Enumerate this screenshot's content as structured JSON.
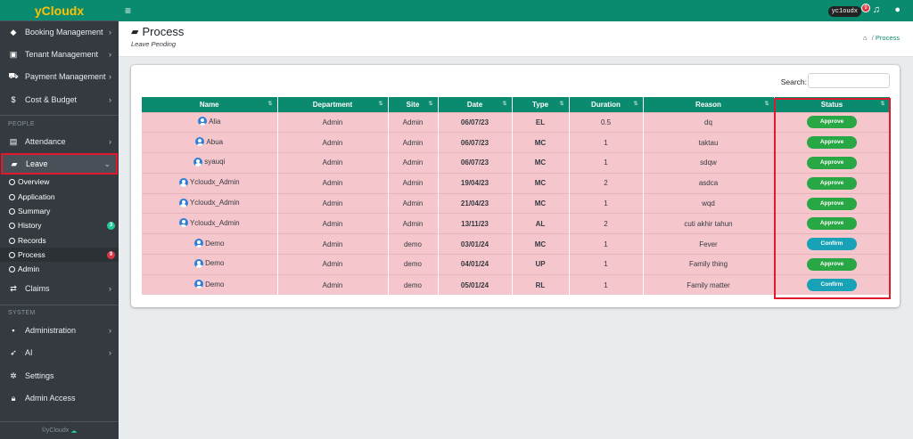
{
  "app": {
    "brand": "yCloudx",
    "footer": "©yCloudx"
  },
  "topbar": {
    "username": "yc1oudx",
    "notifications": "9"
  },
  "sidebar": {
    "main_items": [
      {
        "label": "Booking Management",
        "icon": "key-icon"
      },
      {
        "label": "Tenant Management",
        "icon": "building-icon"
      },
      {
        "label": "Payment Management",
        "icon": "cart-icon"
      },
      {
        "label": "Cost & Budget",
        "icon": "dollar-icon"
      }
    ],
    "section_people": "PEOPLE",
    "attendance": "Attendance",
    "leave": "Leave",
    "leave_sub": [
      {
        "label": "Overview",
        "badge": ""
      },
      {
        "label": "Application",
        "badge": ""
      },
      {
        "label": "Summary",
        "badge": ""
      },
      {
        "label": "History",
        "badge": "3"
      },
      {
        "label": "Records",
        "badge": ""
      },
      {
        "label": "Process",
        "badge": "9"
      },
      {
        "label": "Admin",
        "badge": ""
      }
    ],
    "claims": "Claims",
    "section_system": "SYSTEM",
    "administration": "Administration",
    "ai": "AI",
    "settings": "Settings",
    "admin_access": "Admin Access"
  },
  "header": {
    "title": "Process",
    "subtitle": "Leave Pending",
    "breadcrumb_sep": "/",
    "breadcrumb_current": "Process"
  },
  "search": {
    "label": "Search:"
  },
  "table": {
    "headers": [
      "Name",
      "Department",
      "Site",
      "Date",
      "Type",
      "Duration",
      "Reason",
      "Status"
    ],
    "rows": [
      {
        "name": "Alia",
        "department": "Admin",
        "site": "Admin",
        "date": "06/07/23",
        "type": "EL",
        "duration": "0.5",
        "reason": "dq",
        "status": "Approve"
      },
      {
        "name": "Abua",
        "department": "Admin",
        "site": "Admin",
        "date": "06/07/23",
        "type": "MC",
        "duration": "1",
        "reason": "taktau",
        "status": "Approve"
      },
      {
        "name": "syauqi",
        "department": "Admin",
        "site": "Admin",
        "date": "06/07/23",
        "type": "MC",
        "duration": "1",
        "reason": "sdqw",
        "status": "Approve"
      },
      {
        "name": "Ycloudx_Admin",
        "department": "Admin",
        "site": "Admin",
        "date": "19/04/23",
        "type": "MC",
        "duration": "2",
        "reason": "asdca",
        "status": "Approve"
      },
      {
        "name": "Ycloudx_Admin",
        "department": "Admin",
        "site": "Admin",
        "date": "21/04/23",
        "type": "MC",
        "duration": "1",
        "reason": "wqd",
        "status": "Approve"
      },
      {
        "name": "Ycloudx_Admin",
        "department": "Admin",
        "site": "Admin",
        "date": "13/11/23",
        "type": "AL",
        "duration": "2",
        "reason": "cuti akhir tahun",
        "status": "Approve"
      },
      {
        "name": "Demo",
        "department": "Admin",
        "site": "demo",
        "date": "03/01/24",
        "type": "MC",
        "duration": "1",
        "reason": "Fever",
        "status": "Confirm"
      },
      {
        "name": "Demo",
        "department": "Admin",
        "site": "demo",
        "date": "04/01/24",
        "type": "UP",
        "duration": "1",
        "reason": "Family thing",
        "status": "Approve"
      },
      {
        "name": "Demo",
        "department": "Admin",
        "site": "demo",
        "date": "05/01/24",
        "type": "RL",
        "duration": "1",
        "reason": "Family matter",
        "status": "Confirm"
      }
    ]
  },
  "colors": {
    "brand": "#0a8a6e",
    "row_bg": "#f6c6cd",
    "approve": "#28a745",
    "confirm": "#17a2b8",
    "highlight": "#e0192c"
  }
}
